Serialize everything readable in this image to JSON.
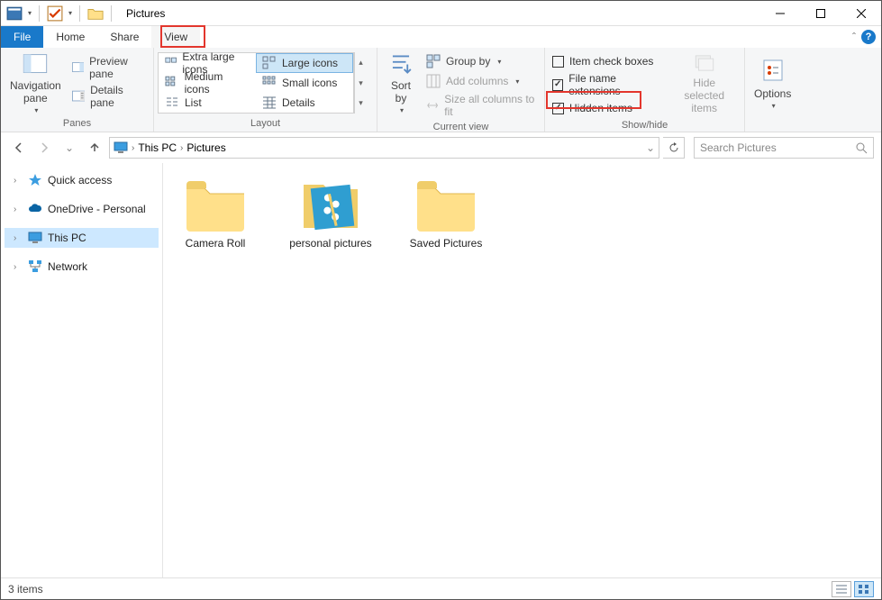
{
  "window": {
    "title": "Pictures"
  },
  "menu": {
    "file": "File",
    "tabs": [
      "Home",
      "Share",
      "View"
    ],
    "active": "View"
  },
  "ribbon": {
    "panes": {
      "navigation_pane": "Navigation\npane",
      "preview_pane": "Preview pane",
      "details_pane": "Details pane",
      "group_label": "Panes"
    },
    "layout": {
      "items": [
        "Extra large icons",
        "Large icons",
        "Medium icons",
        "Small icons",
        "List",
        "Details"
      ],
      "selected": "Large icons",
      "group_label": "Layout"
    },
    "current_view": {
      "sort_by": "Sort\nby",
      "group_by": "Group by",
      "add_columns": "Add columns",
      "size_all": "Size all columns to fit",
      "group_label": "Current view"
    },
    "show_hide": {
      "item_check_boxes": {
        "label": "Item check boxes",
        "checked": false
      },
      "file_name_ext": {
        "label": "File name extensions",
        "checked": true
      },
      "hidden_items": {
        "label": "Hidden items",
        "checked": true
      },
      "hide_selected": "Hide selected\nitems",
      "group_label": "Show/hide"
    },
    "options": "Options"
  },
  "address": {
    "segments": [
      "This PC",
      "Pictures"
    ]
  },
  "search": {
    "placeholder": "Search Pictures"
  },
  "tree": {
    "items": [
      {
        "label": "Quick access",
        "icon": "star",
        "expandable": true,
        "selected": false
      },
      {
        "label": "OneDrive - Personal",
        "icon": "cloud",
        "expandable": true,
        "selected": false
      },
      {
        "label": "This PC",
        "icon": "monitor",
        "expandable": true,
        "selected": true
      },
      {
        "label": "Network",
        "icon": "network",
        "expandable": true,
        "selected": false
      }
    ]
  },
  "items": [
    {
      "label": "Camera Roll",
      "type": "folder"
    },
    {
      "label": "personal pictures",
      "type": "folder-special"
    },
    {
      "label": "Saved Pictures",
      "type": "folder"
    }
  ],
  "status": {
    "count_text": "3 items"
  }
}
